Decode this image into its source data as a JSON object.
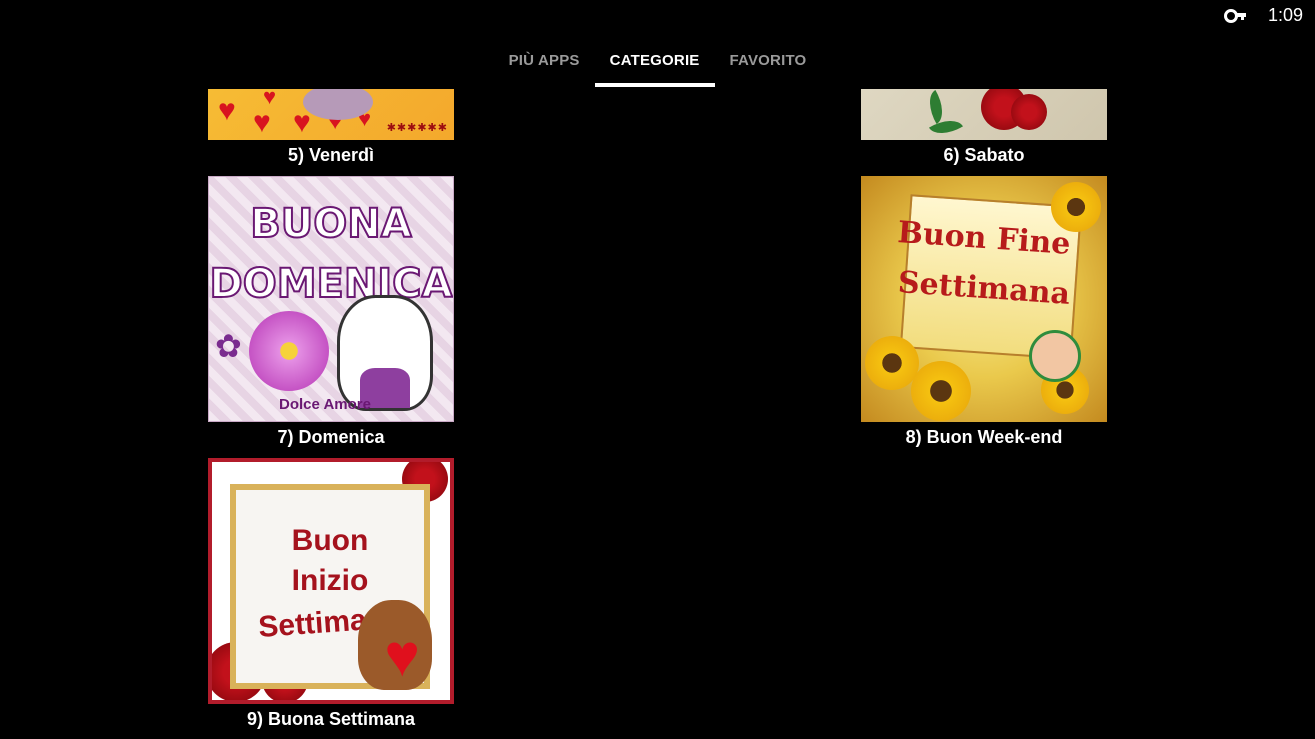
{
  "status": {
    "time": "1:09",
    "icon": "key-icon"
  },
  "tabs": [
    {
      "label": "PIÙ APPS",
      "active": false
    },
    {
      "label": "CATEGORIE",
      "active": true
    },
    {
      "label": "FAVORITO",
      "active": false
    }
  ],
  "cards": [
    {
      "label": "5) Venerdì"
    },
    {
      "label": "6) Sabato"
    },
    {
      "label": "7) Domenica",
      "image_text_1": "BUONA",
      "image_text_2": "DOMENICA",
      "image_signature": "Dolce Amore"
    },
    {
      "label": "8) Buon Week-end",
      "image_text_1": "Buon Fine",
      "image_text_2": "Settimana"
    },
    {
      "label": "9) Buona Settimana",
      "image_text_1": "Buon",
      "image_text_2": "Inizio",
      "image_text_3": "Settimana"
    }
  ],
  "colors": {
    "background": "#000000",
    "tab_active": "#ffffff",
    "tab_inactive": "#9a9a9a"
  }
}
